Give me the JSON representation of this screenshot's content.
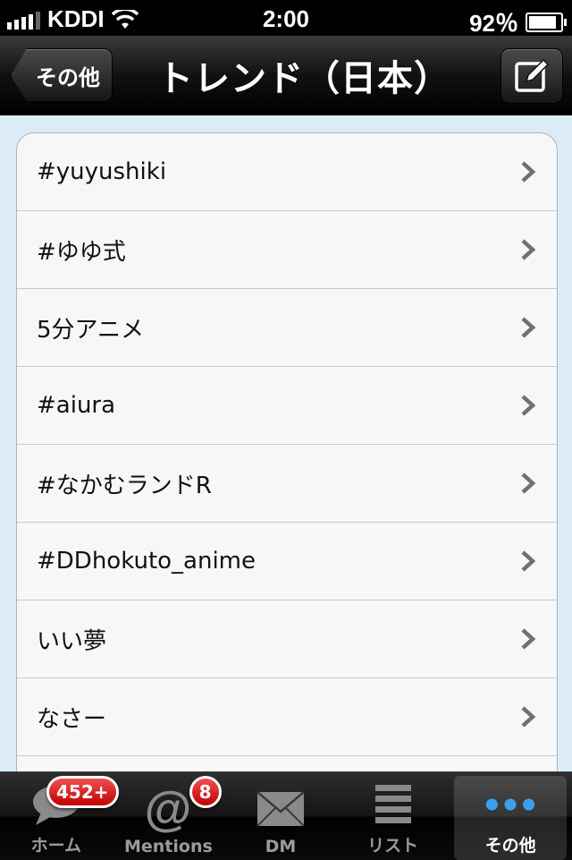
{
  "status_bar": {
    "carrier": "KDDI",
    "time": "2:00",
    "battery": "92％"
  },
  "nav": {
    "back_label": "その他",
    "title": "トレンド（日本）",
    "compose_icon": "compose-icon"
  },
  "trends": [
    {
      "label": "#yuyushiki"
    },
    {
      "label": "#ゆゆ式"
    },
    {
      "label": "5分アニメ"
    },
    {
      "label": "#aiura"
    },
    {
      "label": "#なかむランドR"
    },
    {
      "label": "#DDhokuto_anime"
    },
    {
      "label": "いい夢"
    },
    {
      "label": "なさー"
    }
  ],
  "tabbar": {
    "tabs": [
      {
        "label": "ホーム",
        "icon": "speech-bubble-icon",
        "badge": "452+"
      },
      {
        "label": "Mentions",
        "icon": "at-sign-icon",
        "badge": "8"
      },
      {
        "label": "DM",
        "icon": "envelope-icon"
      },
      {
        "label": "リスト",
        "icon": "list-icon"
      },
      {
        "label": "その他",
        "icon": "more-dots-icon"
      }
    ],
    "selected": "その他"
  }
}
